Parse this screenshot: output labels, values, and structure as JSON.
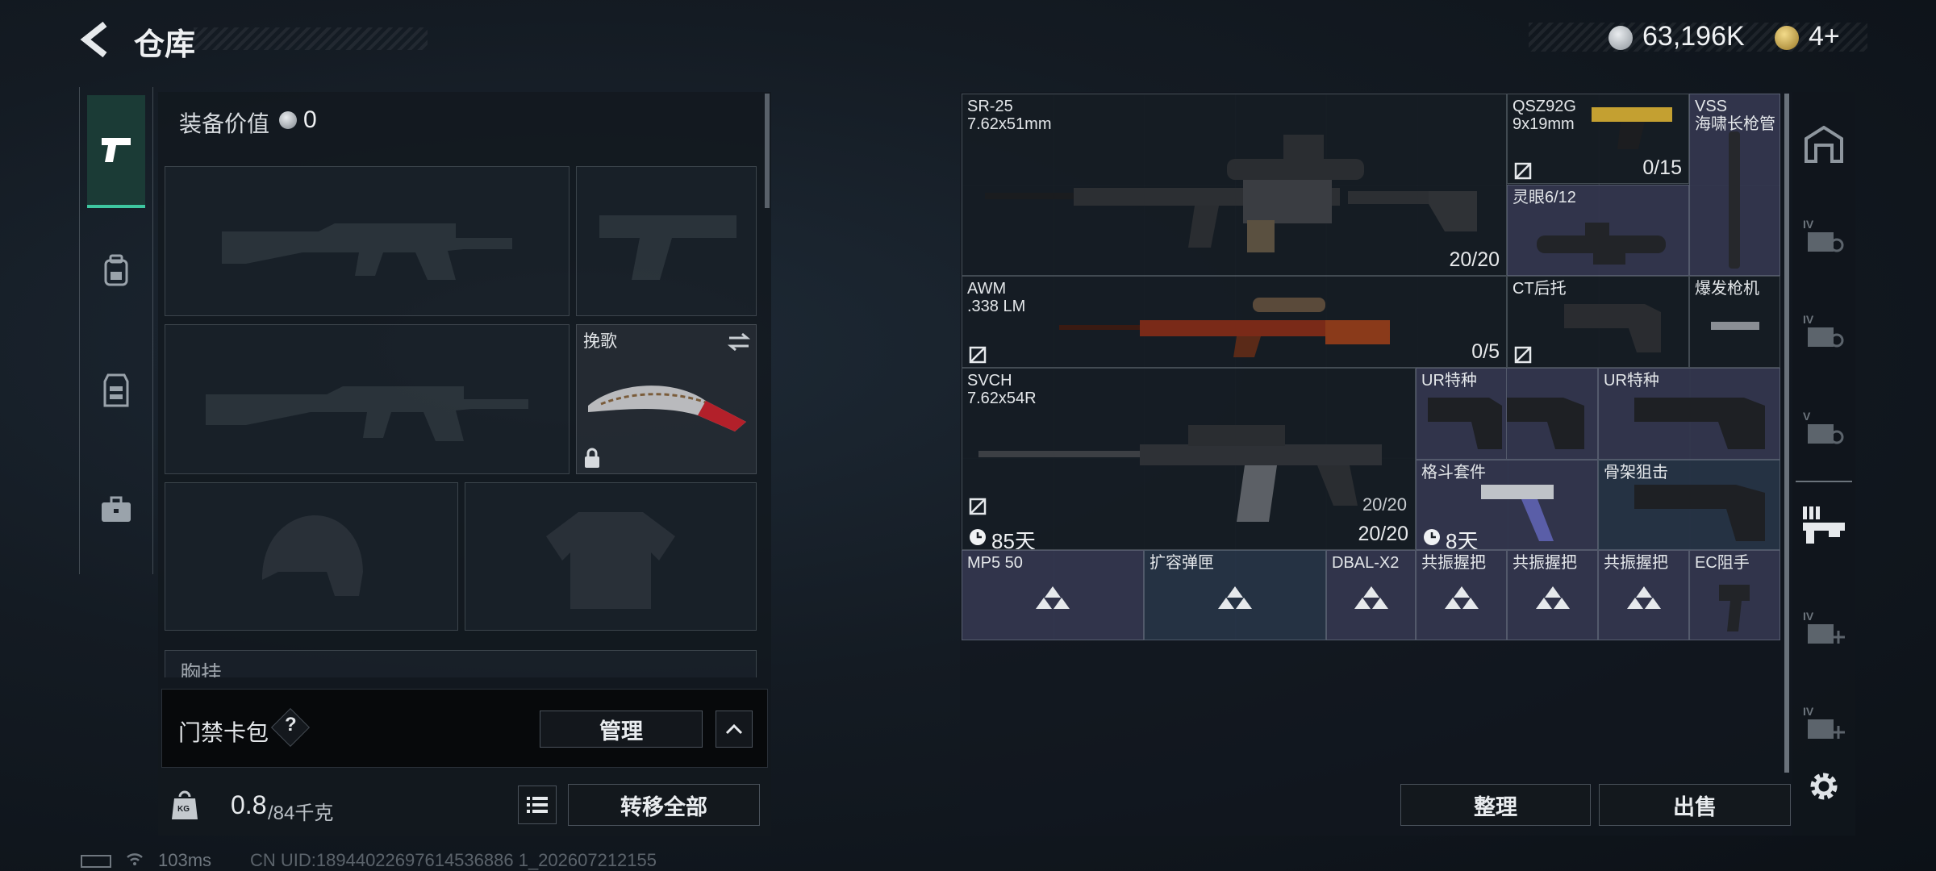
{
  "header": {
    "title": "仓库",
    "currency1": "63,196K",
    "currency2": "4+"
  },
  "left_panel": {
    "equip_value_label": "装备价值",
    "equip_value": "0",
    "melee_label": "挽歌",
    "chest_rig_label": "胸挂",
    "card_pack_label": "门禁卡包",
    "card_help": "?",
    "manage_label": "管理",
    "weight_value": "0.8",
    "weight_max": "/84千克",
    "weight_icon_text": "KG",
    "transfer_all_label": "转移全部"
  },
  "storage": {
    "items": [
      {
        "id": "sr25",
        "name": "SR-25\n7.62x51mm",
        "count": "20/20"
      },
      {
        "id": "qsz",
        "name": "QSZ92G\n9x19mm",
        "count": "0/15"
      },
      {
        "id": "vss",
        "name": "VSS\n海啸长枪管",
        "count": ""
      },
      {
        "id": "scope",
        "name": "灵眼6/12",
        "count": ""
      },
      {
        "id": "awm",
        "name": "AWM\n.338 LM",
        "count": "0/5"
      },
      {
        "id": "ctstock",
        "name": "CT后托",
        "count": ""
      },
      {
        "id": "burst",
        "name": "爆发枪机",
        "count": ""
      },
      {
        "id": "svch",
        "name": "SVCH\n7.62x54R",
        "count": "20/20",
        "extra": "20/20",
        "timer": "85天"
      },
      {
        "id": "ur1",
        "name": "UR特种",
        "count": ""
      },
      {
        "id": "ur2",
        "name": "UR特种",
        "count": ""
      },
      {
        "id": "grip",
        "name": "格斗套件",
        "count": "",
        "timer": "8天"
      },
      {
        "id": "skel",
        "name": "骨架狙击",
        "count": ""
      },
      {
        "id": "mp5",
        "name": "MP5 50",
        "count": ""
      },
      {
        "id": "mag",
        "name": "扩容弹匣",
        "count": ""
      },
      {
        "id": "dbal",
        "name": "DBAL-X2",
        "count": ""
      },
      {
        "id": "res1",
        "name": "共振握把",
        "count": ""
      },
      {
        "id": "res2",
        "name": "共振握把",
        "count": ""
      },
      {
        "id": "res3",
        "name": "共振握把",
        "count": ""
      },
      {
        "id": "ec",
        "name": "EC阻手",
        "count": ""
      }
    ],
    "sort_label": "整理",
    "sell_label": "出售"
  },
  "right_tabs": [
    "IV",
    "IV",
    "V",
    "IV",
    "IV"
  ],
  "status_bar": {
    "ping": "103ms",
    "uid": "CN UID:18944022697614536886 1_202607212155"
  },
  "colors": {
    "accent_green": "#3ec6a0",
    "currency_gold": "#c9a84a",
    "panel": "#12181f"
  }
}
